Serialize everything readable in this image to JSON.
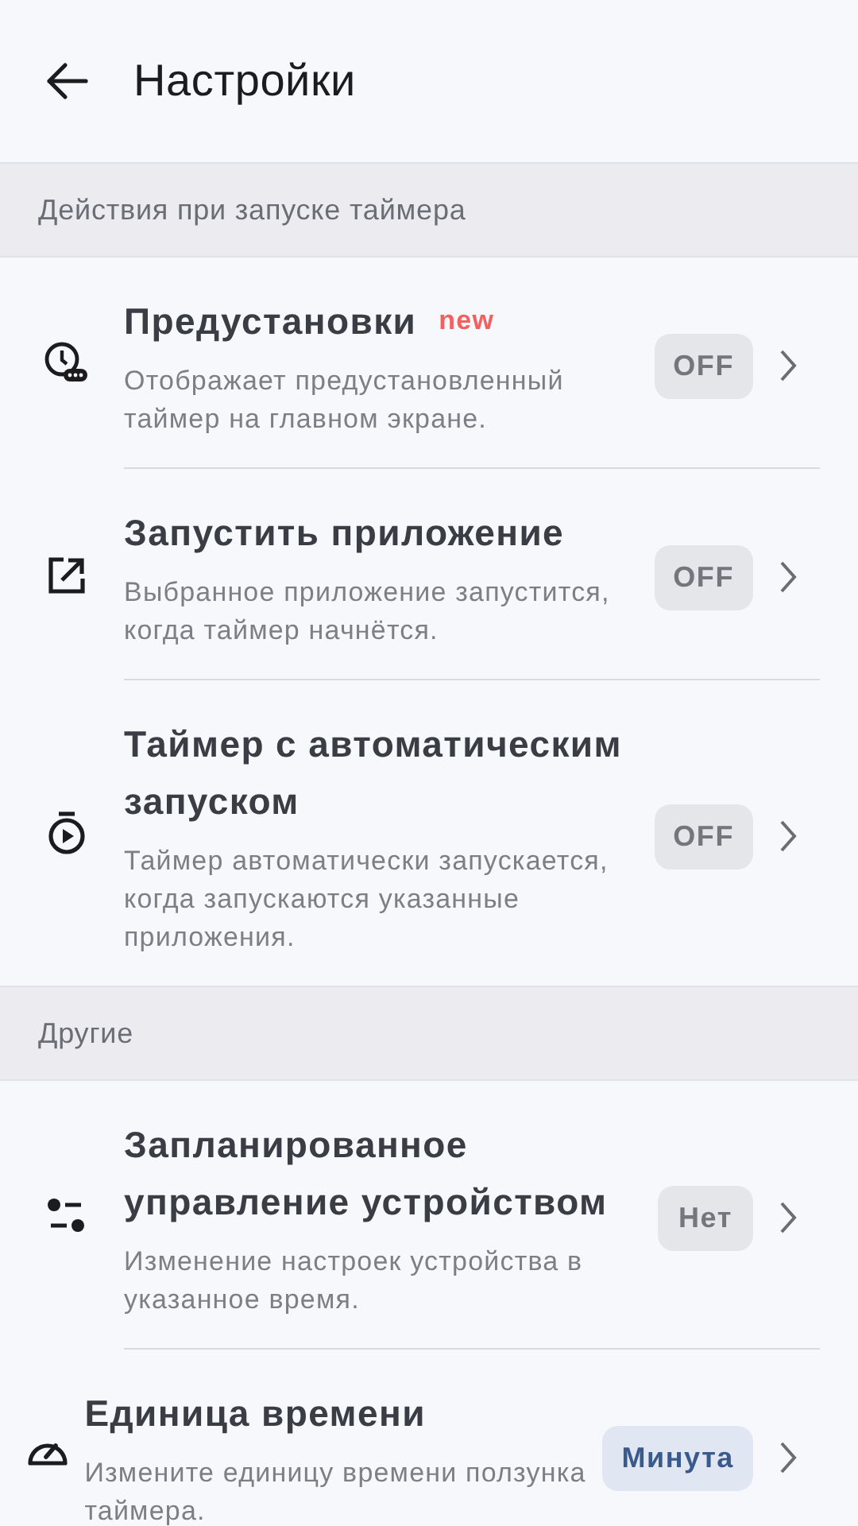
{
  "header": {
    "title": "Настройки"
  },
  "sections": [
    {
      "title": "Действия при запуске таймера",
      "items": [
        {
          "title": "Предустановки",
          "tag": "new",
          "description": "Отображает предустановленный таймер на главном экране.",
          "value": "OFF",
          "active": false
        },
        {
          "title": "Запустить приложение",
          "description": "Выбранное приложение запустится, когда таймер начнётся.",
          "value": "OFF",
          "active": false
        },
        {
          "title": "Таймер с автоматическим запуском",
          "description": "Таймер автоматически запускается, когда запускаются указанные приложения.",
          "value": "OFF",
          "active": false
        }
      ]
    },
    {
      "title": "Другие",
      "items": [
        {
          "title": "Запланированное управление устройством",
          "description": "Изменение настроек устройства в указанное время.",
          "value": "Нет",
          "active": false
        },
        {
          "title": "Единица времени",
          "description": "Измените единицу времени ползунка таймера.",
          "value": "Минута",
          "active": true
        }
      ]
    }
  ]
}
